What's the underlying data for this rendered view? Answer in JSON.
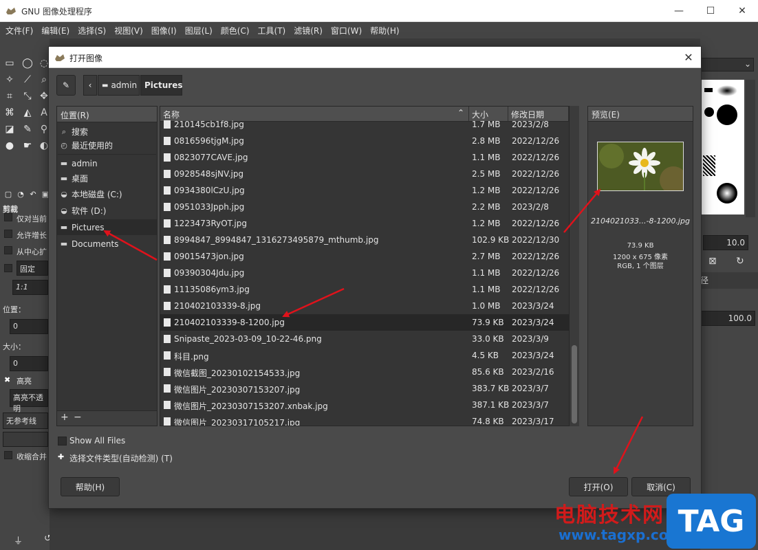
{
  "window": {
    "title": "GNU 图像处理程序"
  },
  "menubar": [
    "文件(F)",
    "编辑(E)",
    "选择(S)",
    "视图(V)",
    "图像(I)",
    "图层(L)",
    "颜色(C)",
    "工具(T)",
    "滤镜(R)",
    "窗口(W)",
    "帮助(H)"
  ],
  "toolbox_options": {
    "title": "剪裁",
    "only_current_layer": "仅对当前",
    "allow_grow": "允许增长",
    "from_center": "从中心扩",
    "fixed": "固定",
    "ratio": "1:1",
    "position_label": "位置：",
    "position_value": "0",
    "size_label": "大小：",
    "size_value": "0",
    "highlight": "高亮",
    "highlight_opacity": "高亮不透明",
    "guides": "无参考线",
    "shrink_merged": "收缩合并"
  },
  "right_dock": {
    "brush_size": "10.0",
    "opacity": "100.0",
    "tab_label": "径"
  },
  "dialog": {
    "title": "打开图像",
    "path": [
      "admin",
      "Pictures"
    ],
    "places_header": "位置(R)",
    "places": [
      {
        "icon": "search-icon",
        "label": "搜索"
      },
      {
        "icon": "recent-icon",
        "label": "最近使用的"
      },
      {
        "icon": "folder-icon",
        "label": "admin"
      },
      {
        "icon": "folder-icon",
        "label": "桌面"
      },
      {
        "icon": "drive-icon",
        "label": "本地磁盘 (C:)"
      },
      {
        "icon": "drive-icon",
        "label": "软件 (D:)"
      },
      {
        "icon": "folder-icon",
        "label": "Pictures"
      },
      {
        "icon": "folder-icon",
        "label": "Documents"
      }
    ],
    "columns": {
      "name": "名称",
      "size": "大小",
      "modified": "修改日期"
    },
    "files": [
      {
        "name": "210145cb1f8.jpg",
        "size": "1.7 MB",
        "date": "2023/2/8"
      },
      {
        "name": "0816596tjgM.jpg",
        "size": "2.8 MB",
        "date": "2022/12/26"
      },
      {
        "name": "0823077CAVE.jpg",
        "size": "1.1 MB",
        "date": "2022/12/26"
      },
      {
        "name": "0928548sjNV.jpg",
        "size": "2.5 MB",
        "date": "2022/12/26"
      },
      {
        "name": "0934380lCzU.jpg",
        "size": "1.2 MB",
        "date": "2022/12/26"
      },
      {
        "name": "0951033Jpph.jpg",
        "size": "2.2 MB",
        "date": "2023/2/8"
      },
      {
        "name": "1223473RyOT.jpg",
        "size": "1.2 MB",
        "date": "2022/12/26"
      },
      {
        "name": "8994847_8994847_1316273495879_mthumb.jpg",
        "size": "102.9 KB",
        "date": "2022/12/30"
      },
      {
        "name": "09015473jon.jpg",
        "size": "2.7 MB",
        "date": "2022/12/26"
      },
      {
        "name": "09390304Jdu.jpg",
        "size": "1.1 MB",
        "date": "2022/12/26"
      },
      {
        "name": "11135086ym3.jpg",
        "size": "1.1 MB",
        "date": "2022/12/26"
      },
      {
        "name": "210402103339-8.jpg",
        "size": "1.0 MB",
        "date": "2023/3/24"
      },
      {
        "name": "210402103339-8-1200.jpg",
        "size": "73.9 KB",
        "date": "2023/3/24",
        "selected": true
      },
      {
        "name": "Snipaste_2023-03-09_10-22-46.png",
        "size": "33.0 KB",
        "date": "2023/3/9"
      },
      {
        "name": "科目.png",
        "size": "4.5 KB",
        "date": "2023/3/24"
      },
      {
        "name": "微信截图_20230102154533.jpg",
        "size": "85.6 KB",
        "date": "2023/2/16"
      },
      {
        "name": "微信图片_20230307153207.jpg",
        "size": "383.7 KB",
        "date": "2023/3/7"
      },
      {
        "name": "微信图片_20230307153207.xnbak.jpg",
        "size": "387.1 KB",
        "date": "2023/3/7"
      },
      {
        "name": "微信图片_20230317105217.jpg",
        "size": "74.8 KB",
        "date": "2023/3/17"
      }
    ],
    "preview": {
      "header": "预览(E)",
      "filename": "2104021033...-8-1200.jpg",
      "size": "73.9 KB",
      "dimensions": "1200 x 675 像素",
      "mode": "RGB, 1 个图层"
    },
    "show_all_files": "Show All Files",
    "file_type": "选择文件类型(自动检测) (T)",
    "help_button": "帮助(H)",
    "open_button": "打开(O)",
    "cancel_button": "取消(C)"
  },
  "watermark": {
    "line1": "电脑技术网",
    "line2": "www.tagxp.com",
    "badge": "TAG"
  },
  "colors": {
    "arrow": "#e0121b",
    "dialog_bg": "#4a4a4a",
    "list_bg": "#353535"
  }
}
